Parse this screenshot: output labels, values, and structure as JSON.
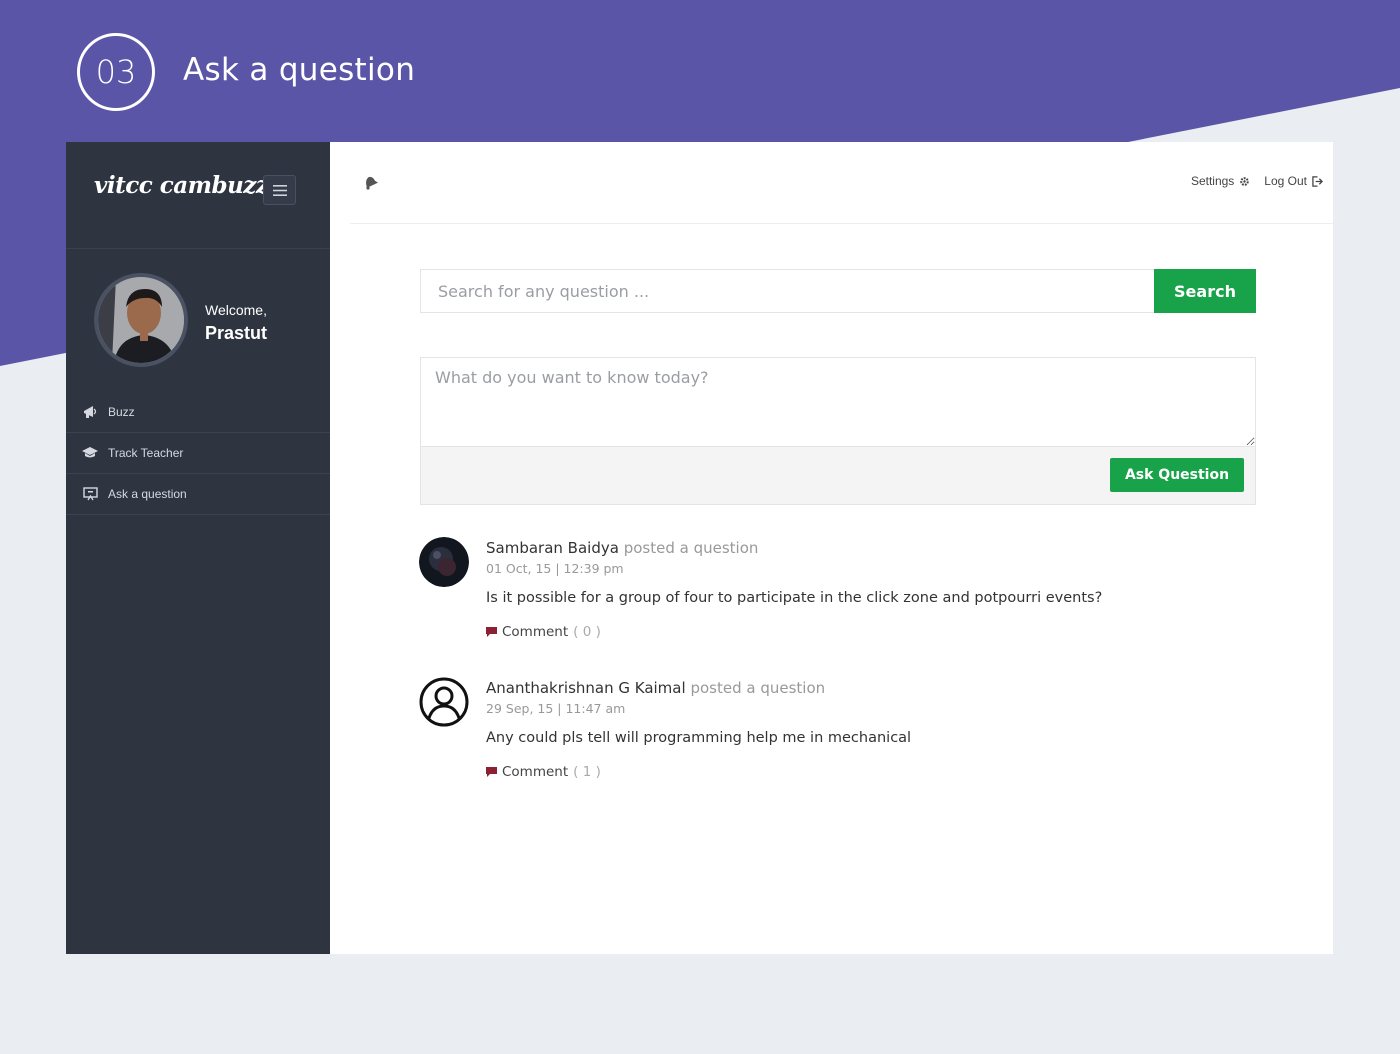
{
  "slide": {
    "step_number": "03",
    "step_title": "Ask a question"
  },
  "sidebar": {
    "brand": "vitcc cambuzz",
    "welcome": "Welcome,",
    "username": "Prastut",
    "items": [
      {
        "label": "Buzz",
        "icon": "megaphone-icon"
      },
      {
        "label": "Track Teacher",
        "icon": "graduation-cap-icon"
      },
      {
        "label": "Ask a question",
        "icon": "question-board-icon"
      }
    ]
  },
  "topbar": {
    "settings_label": "Settings",
    "logout_label": "Log Out"
  },
  "search": {
    "placeholder": "Search for any question ...",
    "button_label": "Search"
  },
  "ask": {
    "placeholder": "What do you want to know today?",
    "button_label": "Ask Question"
  },
  "posts": [
    {
      "author": "Sambaran Baidya",
      "verb": "posted a question",
      "time": "01 Oct, 15 | 12:39 pm",
      "text": "Is it possible for a group of four to participate in the click zone and potpourri events?",
      "comment_label": "Comment",
      "comment_count": "( 0 )"
    },
    {
      "author": "Ananthakrishnan G Kaimal",
      "verb": "posted a question",
      "time": "29 Sep, 15 | 11:47 am",
      "text": "Any could pls tell will programming help me in mechanical",
      "comment_label": "Comment",
      "comment_count": "( 1 )"
    }
  ],
  "colors": {
    "banner": "#5b55a8",
    "sidebar": "#2f3441",
    "accent_green": "#18a34a",
    "page_bg": "#eaeef2"
  }
}
